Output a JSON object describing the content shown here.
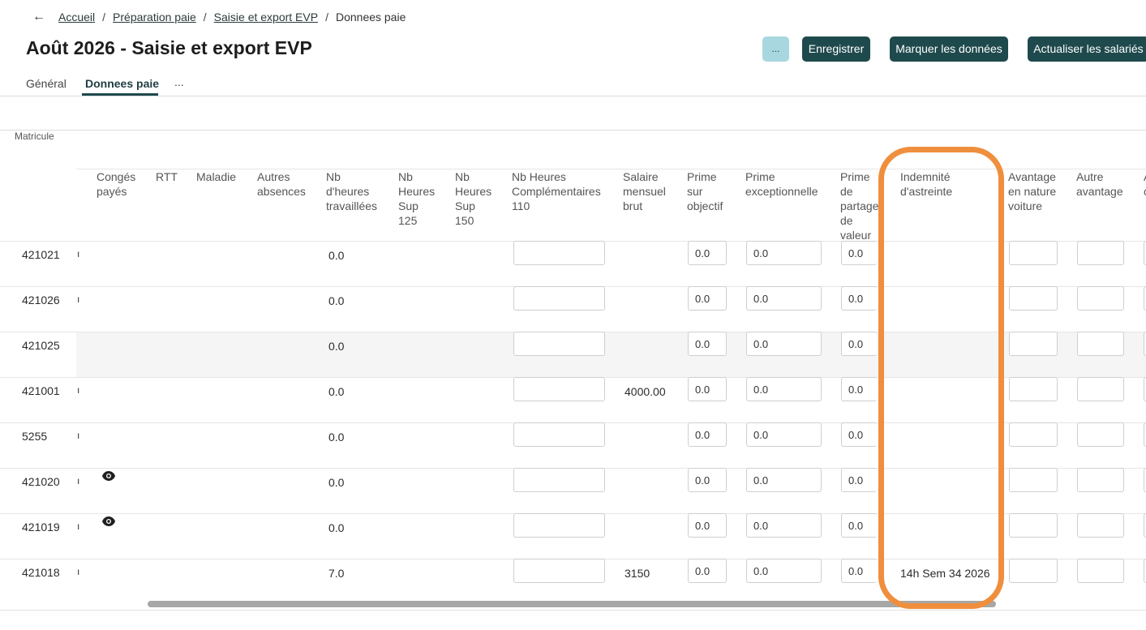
{
  "breadcrumb": {
    "back_icon": "arrow-left-icon",
    "items": [
      "Accueil",
      "Préparation paie",
      "Saisie et export EVP",
      "Donnees paie"
    ],
    "separator": "/"
  },
  "page": {
    "title": "Août 2026 - Saisie et export EVP"
  },
  "toolbar": {
    "more_label": "...",
    "save_label": "Enregistrer",
    "mark_label": "Marquer les données",
    "refresh_label": "Actualiser les salariés"
  },
  "tabs": [
    {
      "label": "Général",
      "active": false
    },
    {
      "label": "Donnees paie",
      "active": true
    },
    {
      "label": "...",
      "active": false
    }
  ],
  "table": {
    "matricule_header": "Matricule",
    "columns": [
      {
        "key": "conges",
        "label": [
          "Congés",
          "payés"
        ]
      },
      {
        "key": "rtt",
        "label": [
          "RTT"
        ]
      },
      {
        "key": "maladie",
        "label": [
          "Maladie"
        ]
      },
      {
        "key": "autres_abs",
        "label": [
          "Autres",
          "absences"
        ]
      },
      {
        "key": "nb_heures",
        "label": [
          "Nb",
          "d'heures",
          "travaillées"
        ]
      },
      {
        "key": "sup125",
        "label": [
          "Nb",
          "Heures",
          "Sup",
          "125"
        ]
      },
      {
        "key": "sup150",
        "label": [
          "Nb",
          "Heures",
          "Sup",
          "150"
        ]
      },
      {
        "key": "compl110",
        "label": [
          "Nb Heures",
          "Complémentaires",
          "110"
        ]
      },
      {
        "key": "salaire",
        "label": [
          "Salaire",
          "mensuel",
          "brut"
        ]
      },
      {
        "key": "prime_obj",
        "label": [
          "Prime",
          "sur",
          "objectif"
        ]
      },
      {
        "key": "prime_exc",
        "label": [
          "Prime",
          "exceptionnelle"
        ]
      },
      {
        "key": "prime_partage",
        "label": [
          "Prime",
          "de",
          "partage",
          "de",
          "valeur"
        ]
      },
      {
        "key": "astreinte",
        "label": [
          "Indemnité",
          "d'astreinte"
        ]
      },
      {
        "key": "avantage_voiture",
        "label": [
          "Avantage",
          "en nature",
          "voiture"
        ]
      },
      {
        "key": "autre_avantage",
        "label": [
          "Autre",
          "avantage"
        ]
      },
      {
        "key": "next",
        "label": [
          "A",
          "c"
        ]
      }
    ],
    "rows": [
      {
        "matricule": "421021",
        "tick": "ı",
        "eye": false,
        "heures": "0.0",
        "salaire": "",
        "prime_obj": "0.0",
        "prime_exc": "0.0",
        "prime_partage": "0.0",
        "astreinte": "",
        "grey": false
      },
      {
        "matricule": "421026",
        "tick": "ı",
        "eye": false,
        "heures": "0.0",
        "salaire": "",
        "prime_obj": "0.0",
        "prime_exc": "0.0",
        "prime_partage": "0.0",
        "astreinte": "",
        "grey": false
      },
      {
        "matricule": "421025",
        "tick": "",
        "eye": false,
        "heures": "0.0",
        "salaire": "",
        "prime_obj": "0.0",
        "prime_exc": "0.0",
        "prime_partage": "0.0",
        "astreinte": "",
        "grey": true
      },
      {
        "matricule": "421001",
        "tick": "ı",
        "eye": false,
        "heures": "0.0",
        "salaire": "4000.00",
        "prime_obj": "0.0",
        "prime_exc": "0.0",
        "prime_partage": "0.0",
        "astreinte": "",
        "grey": false
      },
      {
        "matricule": "5255",
        "tick": "ı",
        "eye": false,
        "heures": "0.0",
        "salaire": "",
        "prime_obj": "0.0",
        "prime_exc": "0.0",
        "prime_partage": "0.0",
        "astreinte": "",
        "grey": false
      },
      {
        "matricule": "421020",
        "tick": "ı",
        "eye": true,
        "heures": "0.0",
        "salaire": "",
        "prime_obj": "0.0",
        "prime_exc": "0.0",
        "prime_partage": "0.0",
        "astreinte": "",
        "grey": false
      },
      {
        "matricule": "421019",
        "tick": "ı",
        "eye": true,
        "heures": "0.0",
        "salaire": "",
        "prime_obj": "0.0",
        "prime_exc": "0.0",
        "prime_partage": "0.0",
        "astreinte": "",
        "grey": false
      },
      {
        "matricule": "421018",
        "tick": "ı",
        "eye": false,
        "heures": "7.0",
        "salaire": "3150",
        "prime_obj": "0.0",
        "prime_exc": "0.0",
        "prime_partage": "0.0",
        "astreinte": "14h Sem 34 2026",
        "grey": false
      }
    ]
  },
  "annotation": {
    "color": "#ef8f3e"
  },
  "colors": {
    "primary": "#1f4a4d",
    "secondary": "#a9d7df"
  }
}
